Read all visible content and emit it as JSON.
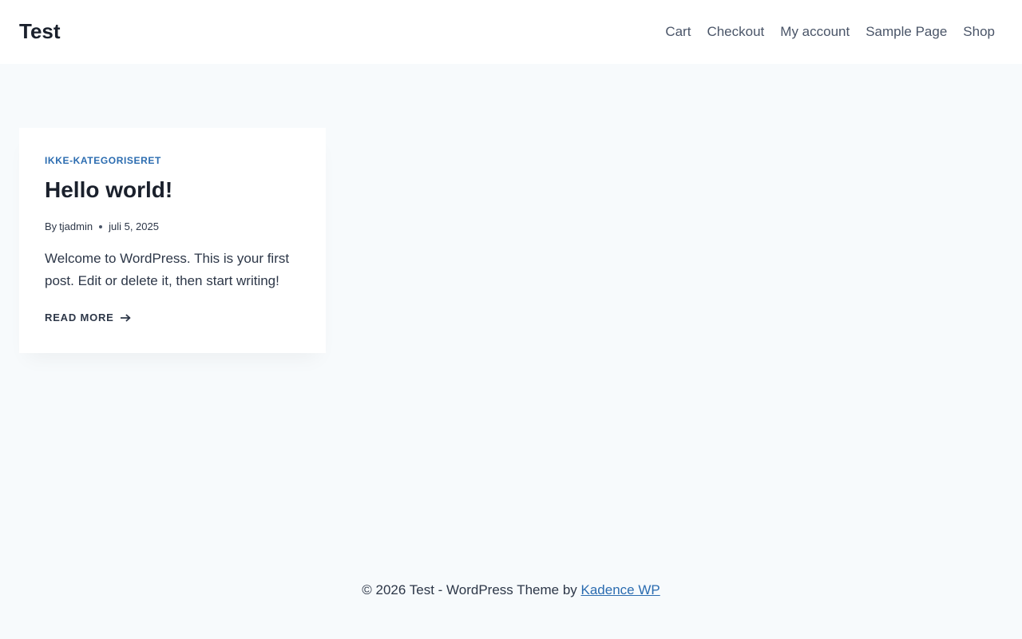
{
  "header": {
    "site_title": "Test",
    "nav": [
      {
        "label": "Cart"
      },
      {
        "label": "Checkout"
      },
      {
        "label": "My account"
      },
      {
        "label": "Sample Page"
      },
      {
        "label": "Shop"
      }
    ]
  },
  "post": {
    "category": "IKKE-KATEGORISERET",
    "title": "Hello world!",
    "by_label": "By",
    "author": "tjadmin",
    "date": "juli 5, 2025",
    "excerpt": "Welcome to WordPress. This is your first post. Edit or delete it, then start writing!",
    "read_more": "READ MORE",
    "read_more_icon": "arrow-right-icon"
  },
  "footer": {
    "text": "© 2026 Test - WordPress Theme by",
    "link_label": "Kadence WP"
  },
  "colors": {
    "accent": "#2b6cb0",
    "background": "#f7fafc",
    "text": "#2d3748",
    "heading": "#1a202c"
  }
}
